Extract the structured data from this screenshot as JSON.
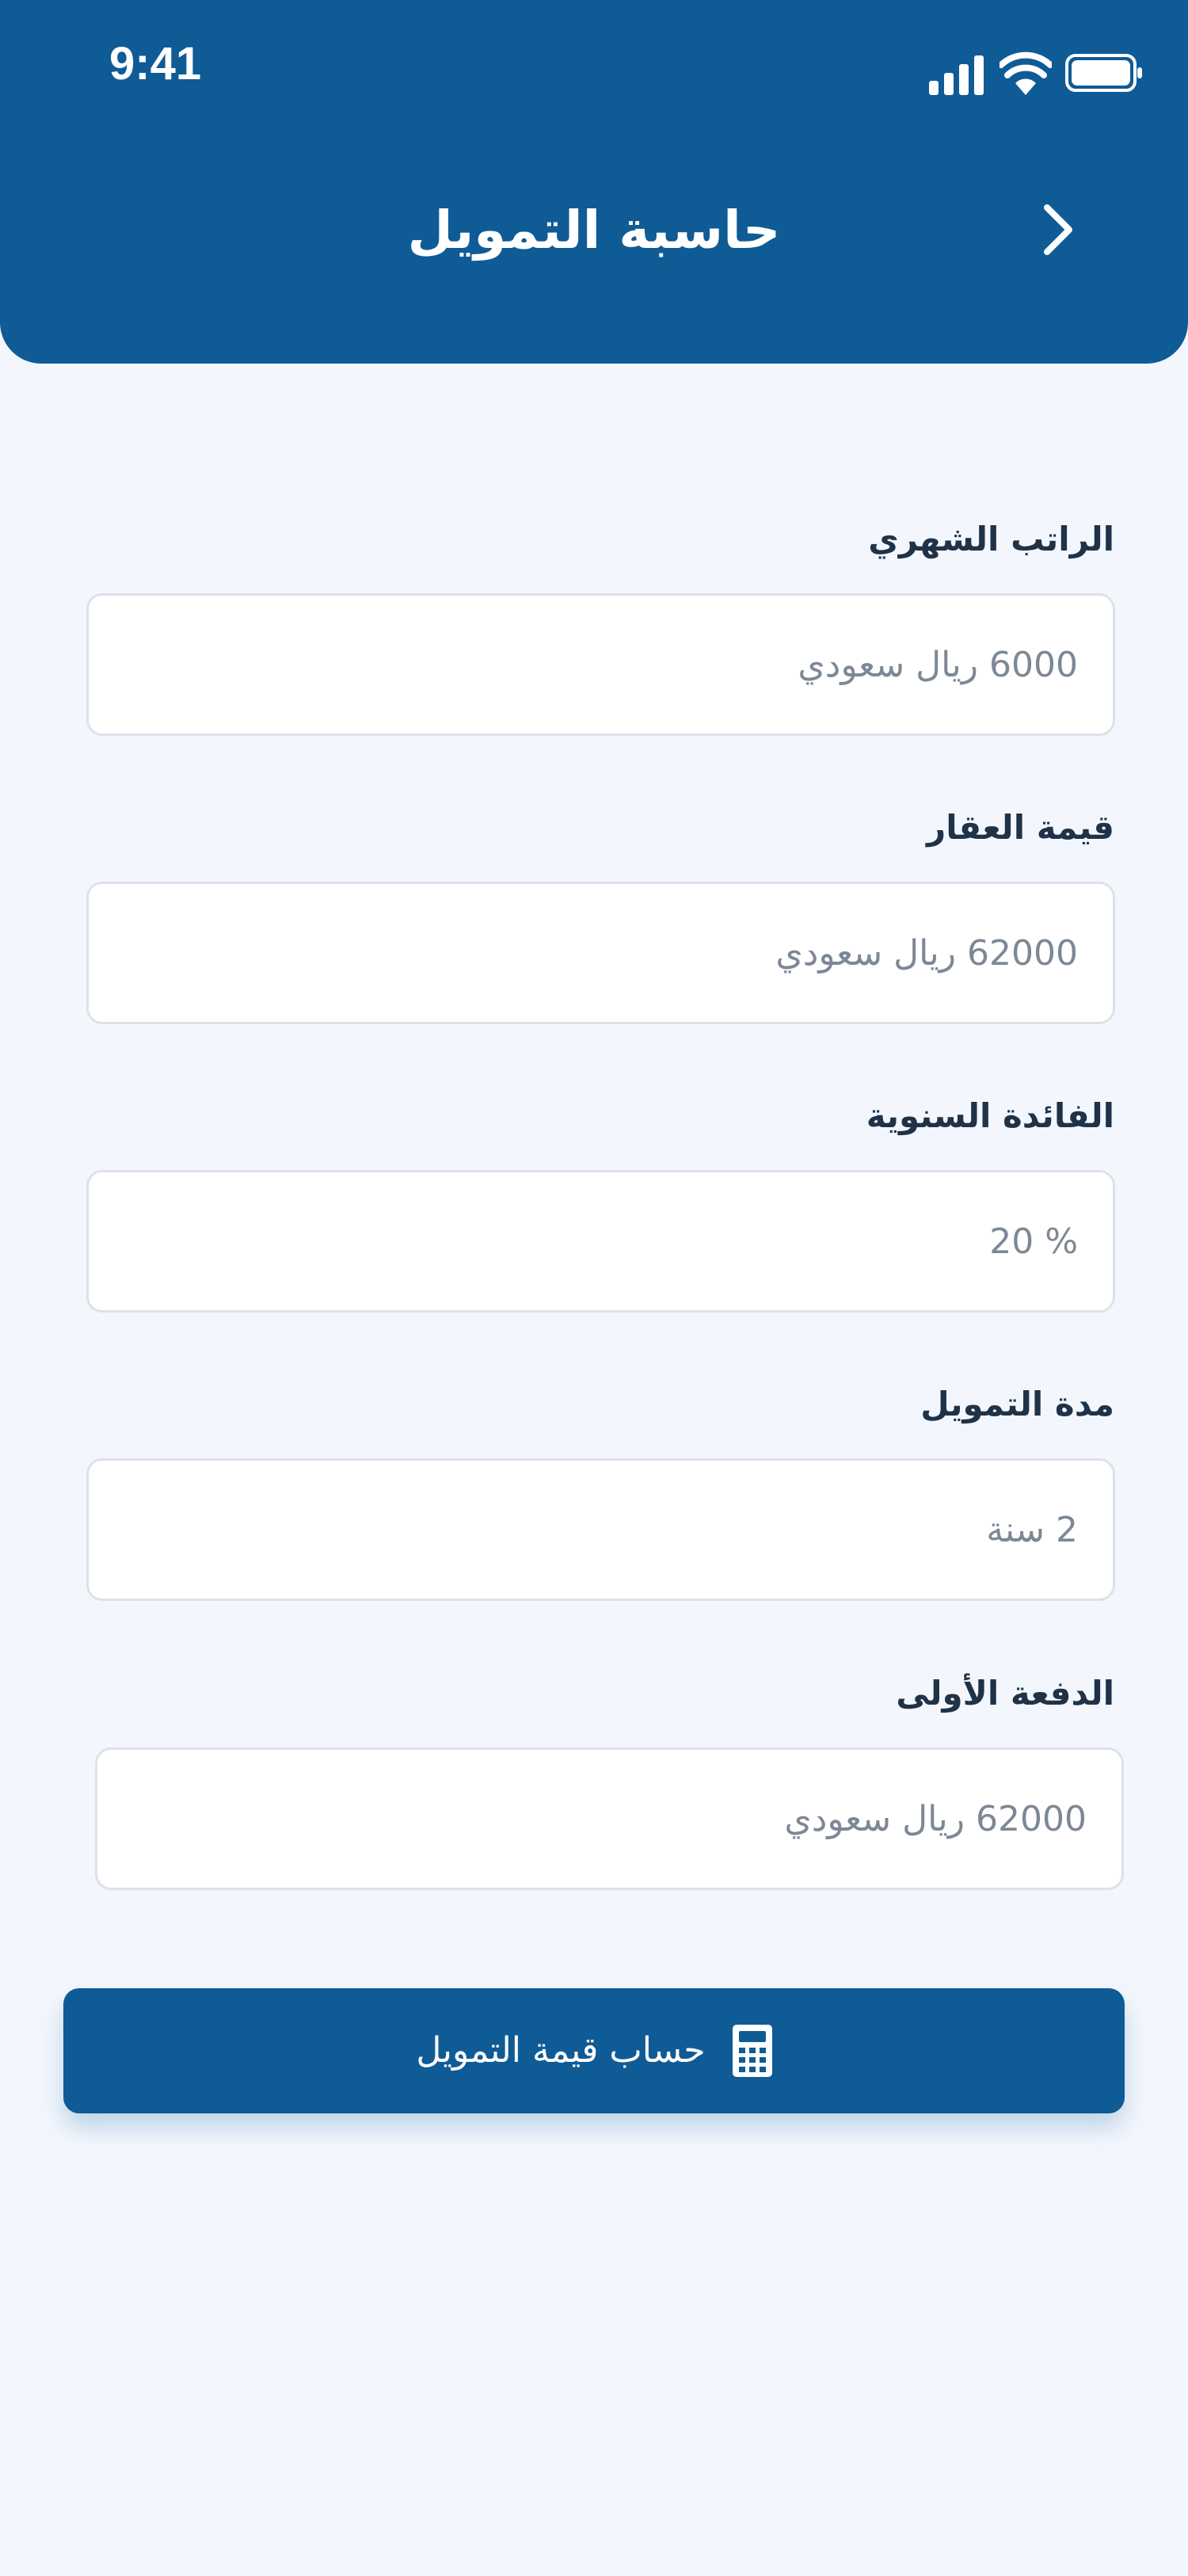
{
  "status_bar": {
    "time": "9:41",
    "icons": [
      "signal-icon",
      "wifi-icon",
      "battery-icon"
    ]
  },
  "header": {
    "title": "حاسبة التمويل",
    "back_icon": "chevron-right-icon"
  },
  "form": {
    "fields": [
      {
        "label": "الراتب الشهري",
        "placeholder": "6000 ريال سعودي"
      },
      {
        "label": "قيمة العقار",
        "placeholder": "62000 ريال سعودي"
      },
      {
        "label": "الفائدة السنوية",
        "placeholder": "% 20"
      },
      {
        "label": "مدة التمويل",
        "placeholder": "2 سنة"
      },
      {
        "label": "الدفعة الأولى",
        "placeholder": "62000 ريال سعودي"
      }
    ]
  },
  "submit": {
    "label": "حساب قيمة التمويل",
    "icon": "calculator-icon"
  },
  "colors": {
    "primary": "#0f5b96",
    "background": "#f3f7fd",
    "label_text": "#1f3248",
    "placeholder_text": "#7d8896",
    "input_border": "#dce2ea"
  }
}
